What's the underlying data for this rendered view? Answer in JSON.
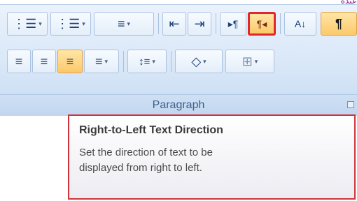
{
  "top_right_text": "عيدة",
  "ribbon": {
    "group_label": "Paragraph",
    "row1": [
      {
        "name": "bullets-button",
        "icon": "⋮☰",
        "dropdown": "▾"
      },
      {
        "name": "numbering-button",
        "icon": "⋮☰",
        "dropdown": "▾"
      },
      {
        "name": "multilevel-list-button",
        "icon": "≡",
        "dropdown": "▾"
      },
      {
        "name": "decrease-indent-button",
        "icon": "⇤"
      },
      {
        "name": "increase-indent-button",
        "icon": "⇥"
      },
      {
        "name": "ltr-text-direction-button",
        "icon": "▸¶"
      },
      {
        "name": "rtl-text-direction-button",
        "icon": "¶◂"
      },
      {
        "name": "sort-button",
        "icon": "A↓"
      },
      {
        "name": "show-hide-marks-button",
        "icon": "¶"
      }
    ],
    "row2": [
      {
        "name": "align-left-button",
        "icon": "≡"
      },
      {
        "name": "center-button",
        "icon": "≡"
      },
      {
        "name": "align-right-button",
        "icon": "≡"
      },
      {
        "name": "justify-button",
        "icon": "≡",
        "dropdown": "▾"
      },
      {
        "name": "line-spacing-button",
        "icon": "↕≡",
        "dropdown": "▾"
      },
      {
        "name": "shading-button",
        "icon": "◇",
        "dropdown": "▾"
      },
      {
        "name": "borders-button",
        "icon": "⊞",
        "dropdown": "▾"
      }
    ]
  },
  "tooltip": {
    "title": "Right-to-Left Text Direction",
    "description": "Set the direction of text to be\ndisplayed from right to left."
  }
}
